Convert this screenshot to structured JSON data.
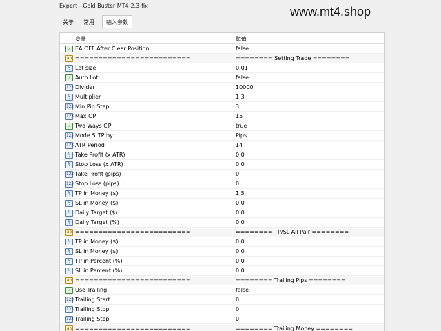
{
  "window": {
    "title": "Expert - Gold Buster MT4-2.3-fix"
  },
  "watermark": "www.mt4.shop",
  "tabs": [
    {
      "label": "关于",
      "active": false
    },
    {
      "label": "常用",
      "active": false
    },
    {
      "label": "输入参数",
      "active": true
    }
  ],
  "table": {
    "headers": {
      "variable": "变量",
      "value": "赋值"
    },
    "rows": [
      {
        "type": "bool",
        "name": "EA OFF After Clear Position",
        "value": "false"
      },
      {
        "type": "str",
        "name": "=========================",
        "value": "======== Setting Trade ========"
      },
      {
        "type": "dbl",
        "name": "Lot size",
        "value": "0.01"
      },
      {
        "type": "bool",
        "name": "Auto Lot",
        "value": "false"
      },
      {
        "type": "int",
        "name": "Divider",
        "value": "10000"
      },
      {
        "type": "dbl",
        "name": "Multiplier",
        "value": "1.3"
      },
      {
        "type": "int",
        "name": "Min Pip Step",
        "value": "3"
      },
      {
        "type": "int",
        "name": "Max OP",
        "value": "15"
      },
      {
        "type": "bool",
        "name": "Two Ways OP",
        "value": "true"
      },
      {
        "type": "enm",
        "name": "Mode SLTP by",
        "value": "Pips"
      },
      {
        "type": "int",
        "name": "ATR Period",
        "value": "14"
      },
      {
        "type": "dbl",
        "name": "Take Profit (x ATR)",
        "value": "0.0"
      },
      {
        "type": "dbl",
        "name": "Stop Loss (x ATR)",
        "value": "0.0"
      },
      {
        "type": "int",
        "name": "Take Profit (pips)",
        "value": "0"
      },
      {
        "type": "int",
        "name": "Stop Loss (pips)",
        "value": "0"
      },
      {
        "type": "dbl",
        "name": "TP in Money ($)",
        "value": "1.5"
      },
      {
        "type": "dbl",
        "name": "SL in Money ($)",
        "value": "0.0"
      },
      {
        "type": "dbl",
        "name": "Daily Target ($)",
        "value": "0.0"
      },
      {
        "type": "dbl",
        "name": "Daily Target (%)",
        "value": "0.0"
      },
      {
        "type": "str",
        "name": "=========================",
        "value": "======== TP/SL All Pair ========"
      },
      {
        "type": "dbl",
        "name": "TP in Money ($)",
        "value": "0.0"
      },
      {
        "type": "dbl",
        "name": "SL in Money ($)",
        "value": "0.0"
      },
      {
        "type": "dbl",
        "name": "TP in Percent (%)",
        "value": "0.0"
      },
      {
        "type": "dbl",
        "name": "SL in Percent (%)",
        "value": "0.0"
      },
      {
        "type": "str",
        "name": "=========================",
        "value": "======== Trailing Pips ========"
      },
      {
        "type": "bool",
        "name": "Use Trailing",
        "value": "false"
      },
      {
        "type": "int",
        "name": "Trailing Start",
        "value": "0"
      },
      {
        "type": "int",
        "name": "Trailing Stop",
        "value": "0"
      },
      {
        "type": "int",
        "name": "Trailing Step",
        "value": "0"
      },
      {
        "type": "str",
        "name": "=========================",
        "value": "======== Trailing Money ========"
      }
    ]
  },
  "icon_glyphs": {
    "bool": "↗",
    "int": "123",
    "dbl": "½",
    "str": "ab",
    "enm": "123"
  }
}
